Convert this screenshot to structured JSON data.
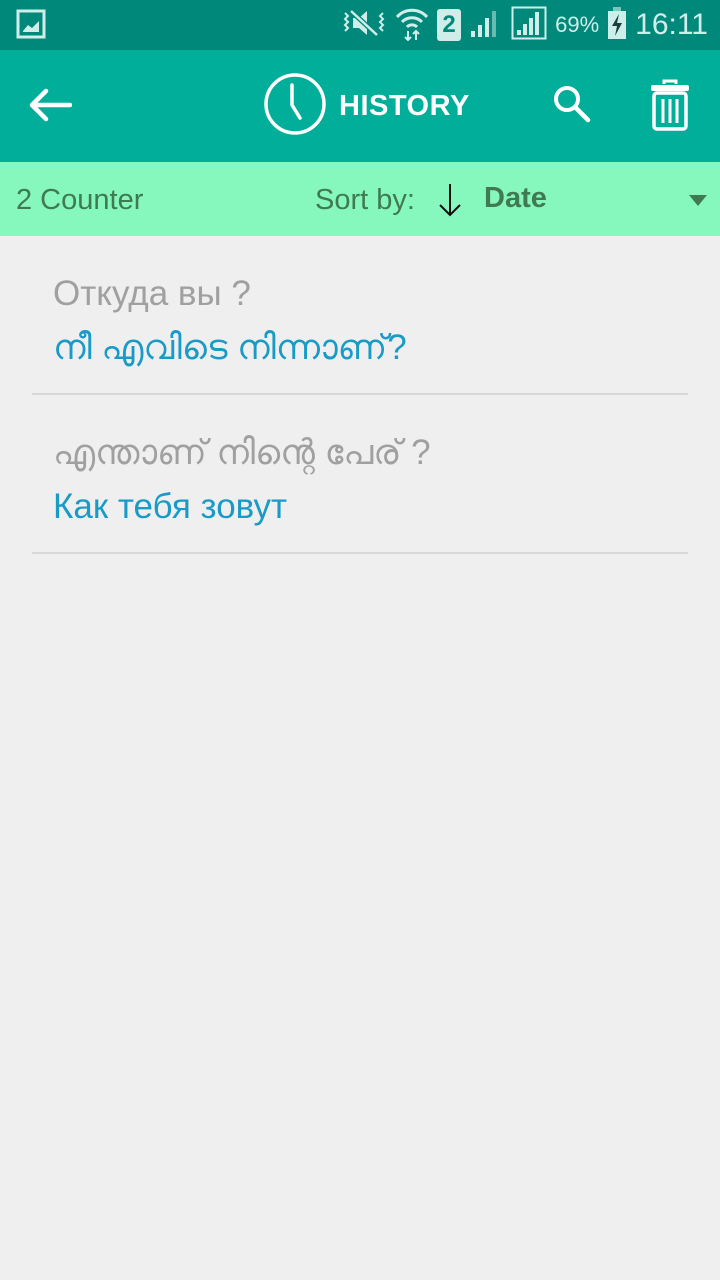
{
  "status_bar": {
    "icons": [
      "gallery-notification-icon",
      "vibrate-mute-icon",
      "wifi-icon",
      "sim2-icon",
      "signal-icon",
      "signal-icon"
    ],
    "sim_label": "2",
    "battery": "69%",
    "time": "16:11"
  },
  "app_bar": {
    "title": "HISTORY",
    "back_icon": "arrow-left-icon",
    "title_icon": "clock-icon",
    "search_icon": "search-icon",
    "delete_icon": "trash-icon"
  },
  "sort_bar": {
    "counter": "2 Counter",
    "sort_label": "Sort by:",
    "sort_direction_icon": "arrow-down-icon",
    "sort_value": "Date"
  },
  "history": [
    {
      "source": "Откуда вы ?",
      "translation": "നീ എവിടെ നിന്നാണ്?"
    },
    {
      "source": "എന്താണ് നിന്റെ പേര് ?",
      "translation": "Как тебя зовут"
    }
  ],
  "colors": {
    "status_bar": "#00897b",
    "app_bar": "#00ae9a",
    "sort_bar": "#86f8bd",
    "source_text": "#a0a0a0",
    "translation_text": "#1a9bc7"
  }
}
